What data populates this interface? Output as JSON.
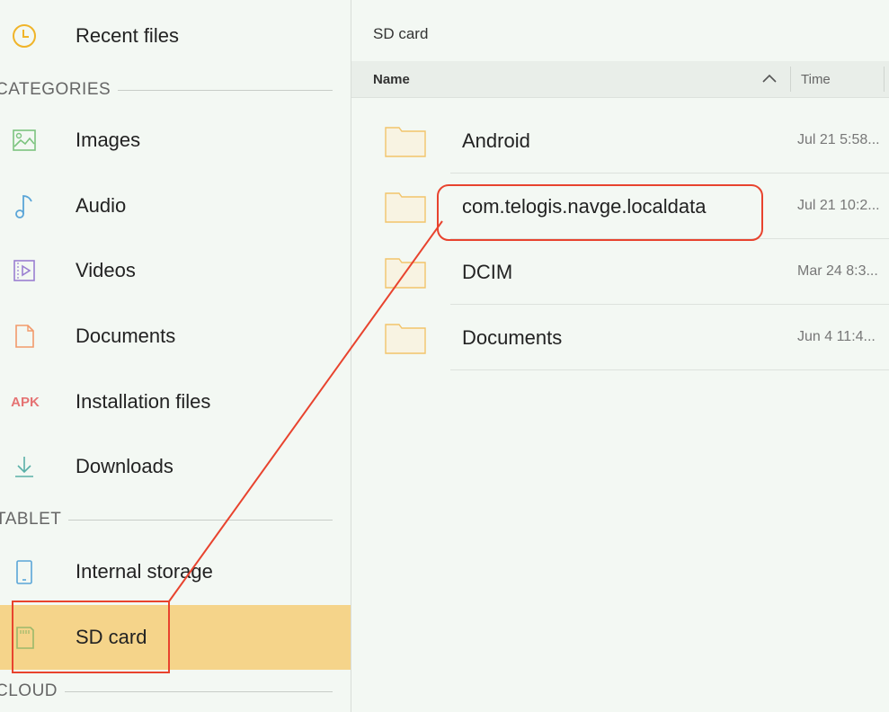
{
  "sidebar": {
    "recent": {
      "label": "Recent files",
      "icon": "clock-icon"
    },
    "sections": {
      "categories": "CATEGORIES",
      "tablet": "TABLET",
      "cloud": "CLOUD"
    },
    "categories": [
      {
        "label": "Images",
        "icon": "image-icon"
      },
      {
        "label": "Audio",
        "icon": "music-note-icon"
      },
      {
        "label": "Videos",
        "icon": "video-icon"
      },
      {
        "label": "Documents",
        "icon": "document-icon"
      },
      {
        "label": "Installation files",
        "icon": "apk-icon",
        "icon_text": "APK"
      },
      {
        "label": "Downloads",
        "icon": "download-icon"
      }
    ],
    "storage": [
      {
        "label": "Internal storage",
        "icon": "tablet-icon"
      },
      {
        "label": "SD card",
        "icon": "sd-card-icon",
        "selected": true
      }
    ]
  },
  "main": {
    "title": "SD card",
    "columns": {
      "name": "Name",
      "time": "Time"
    },
    "files": [
      {
        "name": "Android",
        "time": "Jul 21 5:58..."
      },
      {
        "name": "com.telogis.navge.localdata",
        "time": "Jul 21 10:2..."
      },
      {
        "name": "DCIM",
        "time": "Mar 24 8:3..."
      },
      {
        "name": "Documents",
        "time": "Jun 4 11:4..."
      }
    ]
  },
  "colors": {
    "accent": "#f5d48a",
    "annotation": "#e8432e",
    "folder": "#f2c46b",
    "apk": "#e57373"
  }
}
